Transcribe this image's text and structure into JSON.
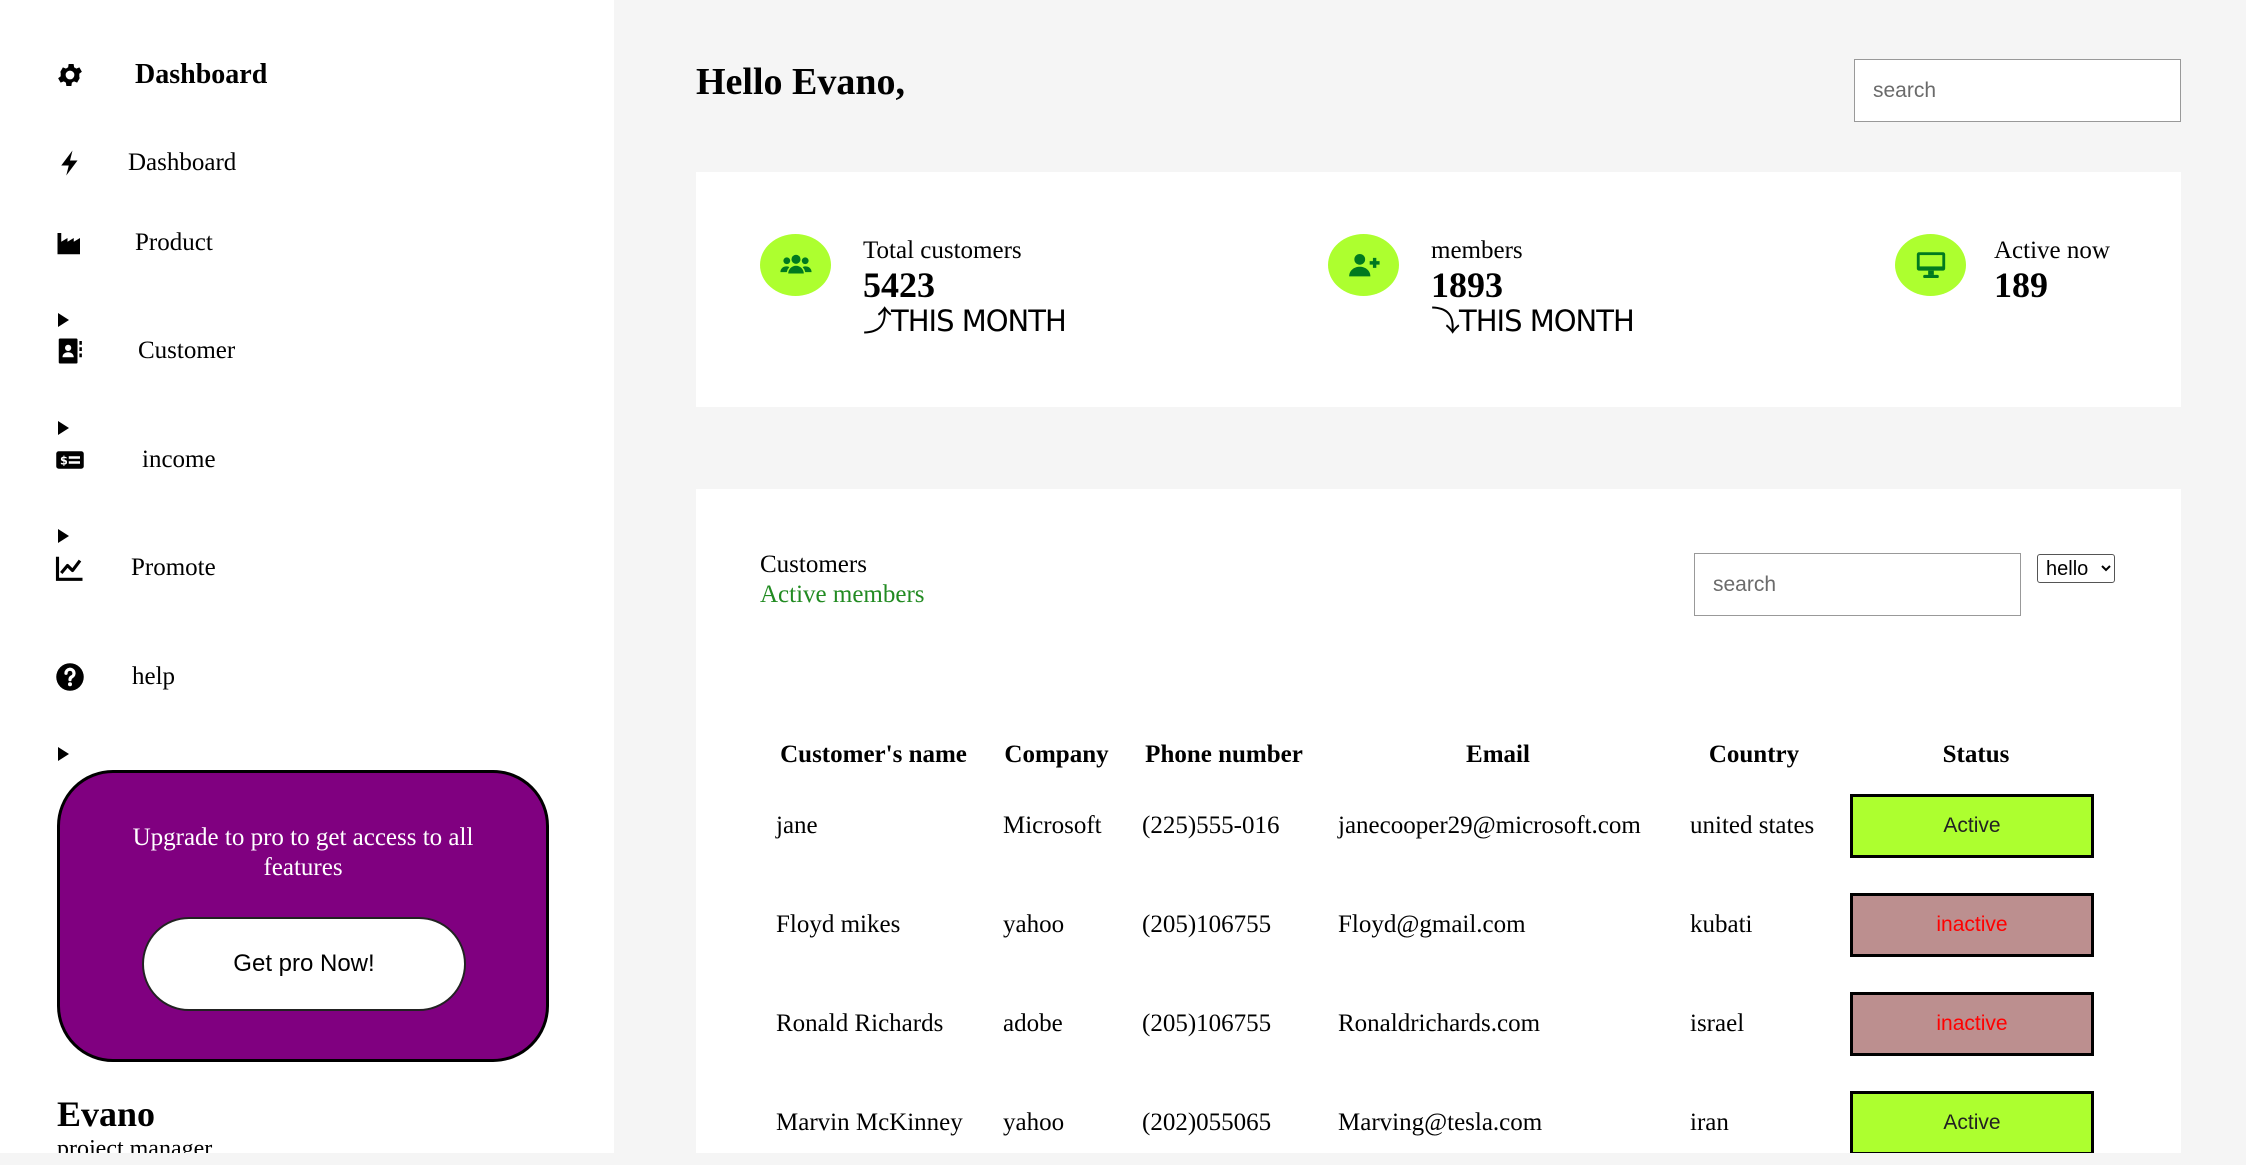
{
  "sidebar": {
    "brand": {
      "label": "Dashboard",
      "icon": "gear-icon"
    },
    "items": [
      {
        "label": "Dashboard",
        "icon": "bolt-icon"
      },
      {
        "label": "Product",
        "icon": "industry-icon"
      },
      {
        "label": "Customer",
        "icon": "contact-book-icon"
      },
      {
        "label": "income",
        "icon": "money-check-icon"
      },
      {
        "label": "Promote",
        "icon": "line-chart-icon"
      },
      {
        "label": "help",
        "icon": "question-circle-icon"
      }
    ],
    "promo": {
      "text": "Upgrade to pro to get access to all features",
      "button_label": "Get pro Now!",
      "color": "#800080"
    },
    "user": {
      "name": "Evano",
      "role": "project manager"
    }
  },
  "header": {
    "greeting": "Hello Evano,",
    "search_placeholder": "search"
  },
  "stats": [
    {
      "label": "Total customers",
      "value": "5423",
      "trend": "⤴THIS MONTH",
      "icon": "users-icon"
    },
    {
      "label": "members",
      "value": "1893",
      "trend": "⤵THIS MONTH",
      "icon": "user-plus-icon"
    },
    {
      "label": "Active now",
      "value": "189",
      "trend": "",
      "icon": "monitor-icon"
    }
  ],
  "accent_color": "#adff2f",
  "customers": {
    "title": "Customers",
    "subtitle": "Active members",
    "search_placeholder": "search",
    "select_value": "hello",
    "columns": [
      "Customer's name",
      "Company",
      "Phone number",
      "Email",
      "Country",
      "Status"
    ],
    "rows": [
      {
        "name": "jane",
        "company": "Microsoft",
        "phone": "(225)555-016",
        "email": "janecooper29@microsoft.com",
        "country": "united states",
        "status": "Active"
      },
      {
        "name": "Floyd mikes",
        "company": "yahoo",
        "phone": "(205)106755",
        "email": "Floyd@gmail.com",
        "country": "kubati",
        "status": "inactive"
      },
      {
        "name": "Ronald Richards",
        "company": "adobe",
        "phone": "(205)106755",
        "email": "Ronaldrichards.com",
        "country": "israel",
        "status": "inactive"
      },
      {
        "name": "Marvin McKinney",
        "company": "yahoo",
        "phone": "(202)055065",
        "email": "Marving@tesla.com",
        "country": "iran",
        "status": "Active"
      }
    ],
    "status_colors": {
      "Active": "#adff2f",
      "inactive": "#bc8f8f"
    }
  }
}
